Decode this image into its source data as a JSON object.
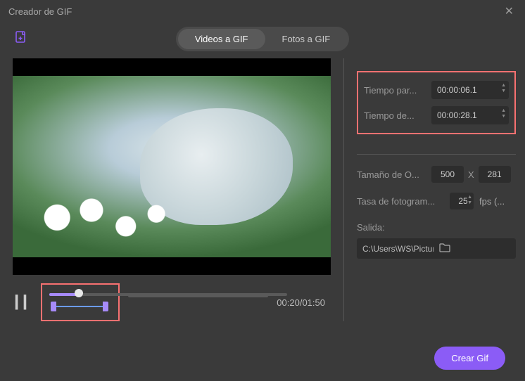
{
  "titlebar": {
    "title": "Creador de GIF"
  },
  "tabs": {
    "videos": "Videos a GIF",
    "photos": "Fotos a GIF"
  },
  "time": {
    "start_label": "Tiempo par...",
    "start_value": "00:00:06.1",
    "end_label": "Tiempo de...",
    "end_value": "00:00:28.1"
  },
  "size": {
    "label": "Tamaño de O...",
    "width": "500",
    "height": "281"
  },
  "fps": {
    "label": "Tasa de fotogram...",
    "value": "25",
    "unit": "fps (..."
  },
  "output": {
    "label": "Salida:",
    "path": "C:\\Users\\WS\\Pictures\\Wonde"
  },
  "playback": {
    "current": "00:20",
    "total": "01:50"
  },
  "actions": {
    "create": "Crear Gif"
  },
  "size_sep": "X"
}
